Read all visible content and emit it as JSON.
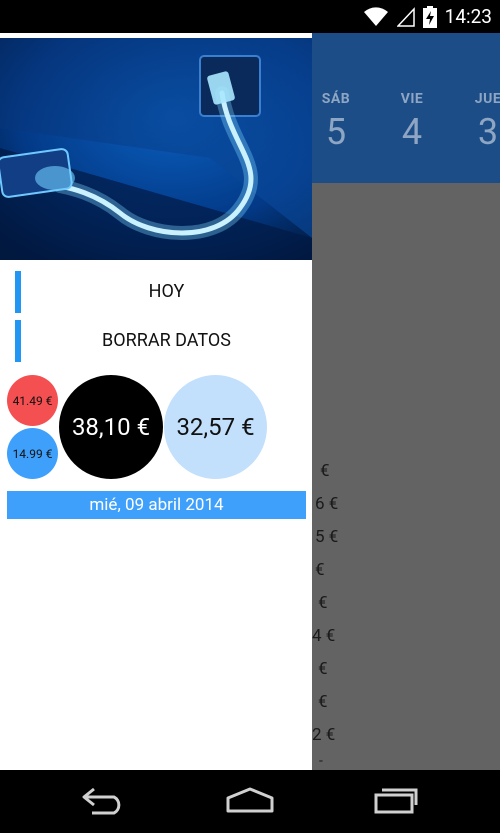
{
  "status_bar": {
    "time": "14:23"
  },
  "calendar": {
    "days": [
      {
        "name": "SÁB",
        "number": "5"
      },
      {
        "name": "VIE",
        "number": "4"
      },
      {
        "name": "JUE",
        "number": "3"
      }
    ]
  },
  "background_list": [
    "€",
    "6 €",
    "5 €",
    "€",
    "€",
    "4 €",
    "€",
    "€",
    "2 €",
    "-"
  ],
  "drawer": {
    "menu": [
      {
        "label": "HOY"
      },
      {
        "label": "BORRAR DATOS"
      }
    ],
    "bubbles": {
      "red_value": "41.49 €",
      "blue_value": "14.99 €",
      "black_value": "38,10 €",
      "light_value": "32,57 €"
    },
    "date": "mié, 09 abril 2014"
  },
  "colors": {
    "accent_blue": "#2196f3",
    "header_blue": "#1d4d86",
    "bubble_red": "#f44f51",
    "bubble_blue": "#3ea0fb",
    "bubble_black": "#000000",
    "bubble_light": "#c2dffc"
  },
  "icons": {
    "status": [
      "wifi-icon",
      "signal-icon",
      "battery-charging-icon"
    ],
    "nav": [
      "back-icon",
      "home-icon",
      "recent-apps-icon"
    ]
  }
}
